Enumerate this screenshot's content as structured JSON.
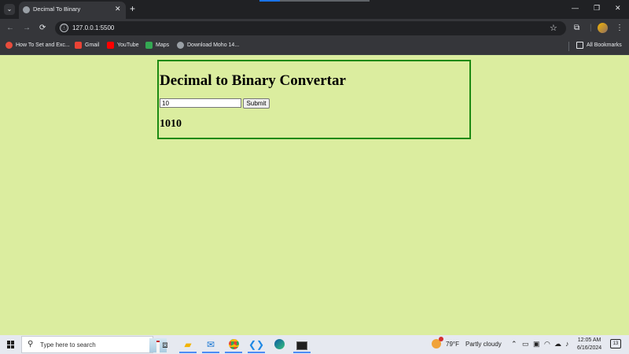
{
  "browser": {
    "tab": {
      "title": "Decimal To Binary",
      "close_glyph": "✕",
      "favicon": "globe-icon"
    },
    "new_tab_glyph": "+",
    "tab_search_glyph": "⌄",
    "window_controls": {
      "minimize": "—",
      "restore": "❐",
      "close": "✕"
    },
    "address": {
      "url": "127.0.0.1:5500",
      "site_info_glyph": "ⓘ"
    },
    "toolbar_glyphs": {
      "back": "←",
      "forward": "→",
      "reload": "⟳",
      "star": "☆",
      "extensions": "⧉",
      "menu": "⋮",
      "divider": "|"
    },
    "bookmarks": [
      {
        "label": "How To Set and Exc...",
        "icon": "red-site-icon",
        "color": "#e74c3c"
      },
      {
        "label": "Gmail",
        "icon": "gmail-icon",
        "color": "#ea4335"
      },
      {
        "label": "YouTube",
        "icon": "youtube-icon",
        "color": "#ff0000"
      },
      {
        "label": "Maps",
        "icon": "maps-icon",
        "color": "#34a853"
      },
      {
        "label": "Download Moho 14...",
        "icon": "globe-icon",
        "color": "#9aa0a6"
      }
    ],
    "all_bookmarks": "All Bookmarks"
  },
  "page": {
    "background": "#dbed9f",
    "border_color": "#1c8a12",
    "title": "Decimal to Binary Convertar",
    "input_value": "10",
    "submit_label": "Submit",
    "result": "1010"
  },
  "taskbar": {
    "search_placeholder": "Type here to search",
    "apps": [
      "task-view-icon",
      "file-explorer-icon",
      "mail-icon",
      "chrome-icon",
      "vscode-icon",
      "edge-icon",
      "terminal-icon"
    ],
    "weather": {
      "temp": "79°F",
      "condition": "Partly cloudy"
    },
    "time": "12:05 AM",
    "date": "6/16/2024",
    "notifications": "13"
  }
}
